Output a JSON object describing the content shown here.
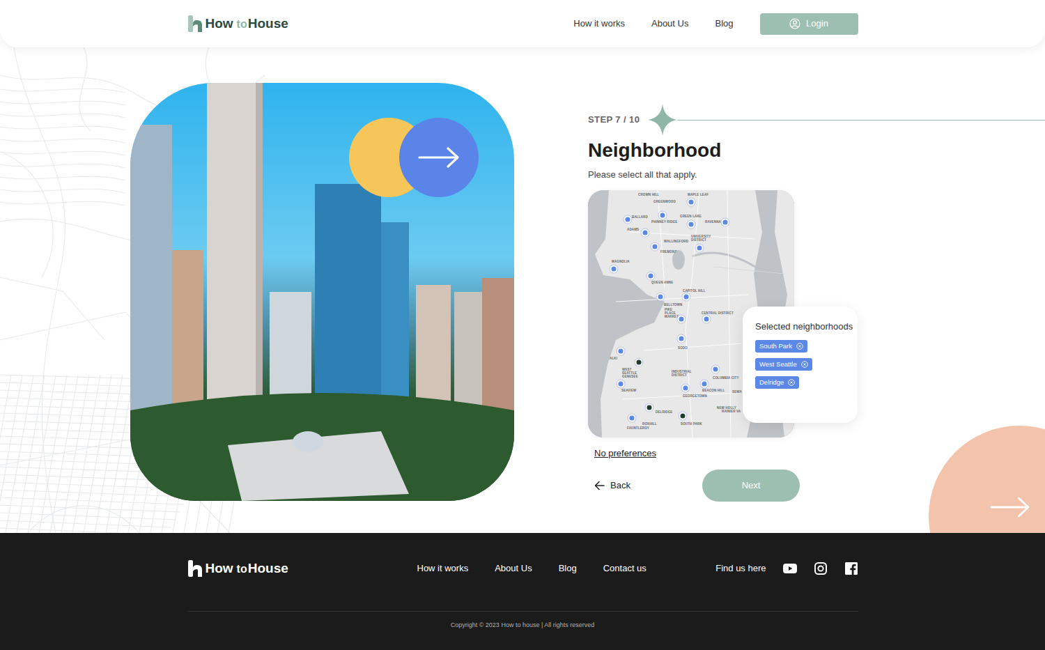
{
  "header": {
    "logo": {
      "first": "How",
      "middle": "to",
      "last": "House"
    },
    "nav": [
      "How it works",
      "About Us",
      "Blog"
    ],
    "login": "Login"
  },
  "step": {
    "label": "STEP 7 / 10",
    "title": "Neighborhood",
    "hint": "Please select all that apply."
  },
  "map": {
    "labels": [
      "CROWN HILL",
      "MAPLE LEAF",
      "GREENWOOD",
      "BALLARD",
      "GREEN LAKE",
      "PHINNEY RIDGE",
      "RAVENNA",
      "ADAMS",
      "UNIVERSITY DISTRICT",
      "WALLINGFORD",
      "FREMONT",
      "MAGNOLIA",
      "QUEEN ANNE",
      "CAPITOL HILL",
      "BELLTOWN",
      "PIKE PLACE MARKET",
      "CENTRAL DISTRICT",
      "SODO",
      "ALKI",
      "WEST SEATTLE GENESEE",
      "INDUSTRIAL DISTRICT",
      "COLUMBIA CITY",
      "SEAVIEW",
      "BEACON HILL",
      "GEORGETOWN",
      "SEWA",
      "NEW HOLLY",
      "RAINIER VA",
      "DELRIDGE",
      "ROXHILL",
      "SOUTH PARK",
      "FAUNTLEROY"
    ],
    "pins": [
      {
        "selected": false
      },
      {
        "selected": false
      },
      {
        "selected": false
      },
      {
        "selected": false
      },
      {
        "selected": false
      },
      {
        "selected": false
      },
      {
        "selected": false
      },
      {
        "selected": false
      },
      {
        "selected": false
      },
      {
        "selected": false
      },
      {
        "selected": false
      },
      {
        "selected": false
      },
      {
        "selected": false
      },
      {
        "selected": false
      },
      {
        "selected": false
      },
      {
        "selected": false
      },
      {
        "selected": true
      },
      {
        "selected": false
      },
      {
        "selected": false
      },
      {
        "selected": false
      },
      {
        "selected": false
      },
      {
        "selected": true
      },
      {
        "selected": true
      },
      {
        "selected": false
      }
    ]
  },
  "selected_panel": {
    "title": "Selected neighborhoods",
    "chips": [
      "South Park",
      "West Seattle",
      "Delridge"
    ]
  },
  "no_preferences": "No preferences",
  "back": "Back",
  "next": "Next",
  "footer": {
    "logo": {
      "first": "How",
      "middle": "to",
      "last": "House"
    },
    "links": [
      "How it works",
      "About Us",
      "Blog",
      "Contact us"
    ],
    "find_us": "Find us here",
    "copyright": "Copyright © 2023 How to house | All rights reserved"
  }
}
